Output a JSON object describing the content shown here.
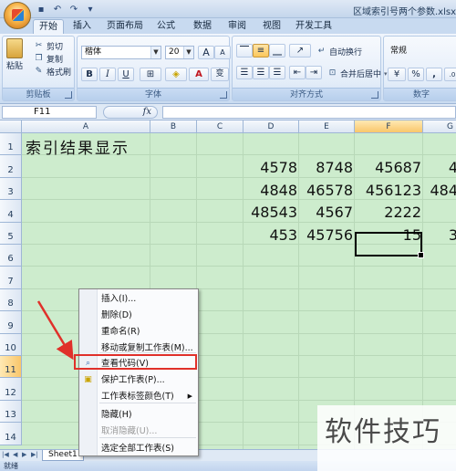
{
  "window": {
    "title": "区域索引号两个参数.xlsx"
  },
  "ribbon_tabs": [
    "开始",
    "插入",
    "页面布局",
    "公式",
    "数据",
    "审阅",
    "视图",
    "开发工具"
  ],
  "clipboard": {
    "group": "剪贴板",
    "paste": "粘贴",
    "cut": "剪切",
    "copy": "复制",
    "format_painter": "格式刷"
  },
  "font": {
    "group": "字体",
    "name": "楷体",
    "size": "20",
    "grow": "A",
    "shrink": "A",
    "bold": "B",
    "italic": "I",
    "underline": "U",
    "font_color": "A",
    "phonetic": "变"
  },
  "alignment": {
    "group": "对齐方式",
    "wrap": "自动换行",
    "merge": "合并后居中"
  },
  "number": {
    "group": "数字",
    "format": "常规",
    "percent": "%",
    "comma": ","
  },
  "formula_bar": {
    "name_box": "F11",
    "fx": "fx"
  },
  "grid": {
    "columns": [
      "A",
      "B",
      "C",
      "D",
      "E",
      "F",
      "G"
    ],
    "rows": [
      "1",
      "2",
      "3",
      "4",
      "5",
      "6",
      "7",
      "8",
      "9",
      "10",
      "11",
      "12",
      "13",
      "14"
    ],
    "title": "索引结果显示",
    "cells": [
      {
        "row": 2,
        "col": "D",
        "value": "4578"
      },
      {
        "row": 2,
        "col": "E",
        "value": "8748"
      },
      {
        "row": 2,
        "col": "F",
        "value": "45687"
      },
      {
        "row": 2,
        "col": "G",
        "value": "4"
      },
      {
        "row": 3,
        "col": "D",
        "value": "4848"
      },
      {
        "row": 3,
        "col": "E",
        "value": "46578"
      },
      {
        "row": 3,
        "col": "F",
        "value": "456123"
      },
      {
        "row": 3,
        "col": "G",
        "value": "484"
      },
      {
        "row": 4,
        "col": "D",
        "value": "48543"
      },
      {
        "row": 4,
        "col": "E",
        "value": "4567"
      },
      {
        "row": 4,
        "col": "F",
        "value": "2222"
      },
      {
        "row": 5,
        "col": "D",
        "value": "453"
      },
      {
        "row": 5,
        "col": "E",
        "value": "45756"
      },
      {
        "row": 5,
        "col": "F",
        "value": "15"
      },
      {
        "row": 5,
        "col": "G",
        "value": "3"
      }
    ]
  },
  "context_menu": {
    "items": [
      {
        "label": "插入(I)...",
        "icon": ""
      },
      {
        "label": "删除(D)",
        "icon": ""
      },
      {
        "label": "重命名(R)",
        "icon": ""
      },
      {
        "label": "移动或复制工作表(M)...",
        "icon": ""
      },
      {
        "label": "查看代码(V)",
        "icon": "view-code-icon"
      },
      {
        "label": "保护工作表(P)...",
        "icon": "protect-sheet-icon"
      },
      {
        "label": "工作表标签颜色(T)",
        "icon": "",
        "submenu": true
      },
      {
        "label": "隐藏(H)",
        "icon": ""
      },
      {
        "label": "取消隐藏(U)...",
        "icon": "",
        "disabled": true
      },
      {
        "label": "选定全部工作表(S)",
        "icon": ""
      }
    ]
  },
  "sheets": {
    "tab1": "Sheet1"
  },
  "status": {
    "ready": "就绪"
  },
  "watermark": "软件技巧",
  "colors": {
    "sheet_bg": "#cdeccd",
    "highlight": "#e0302a",
    "ribbon": "#dce8f7"
  }
}
